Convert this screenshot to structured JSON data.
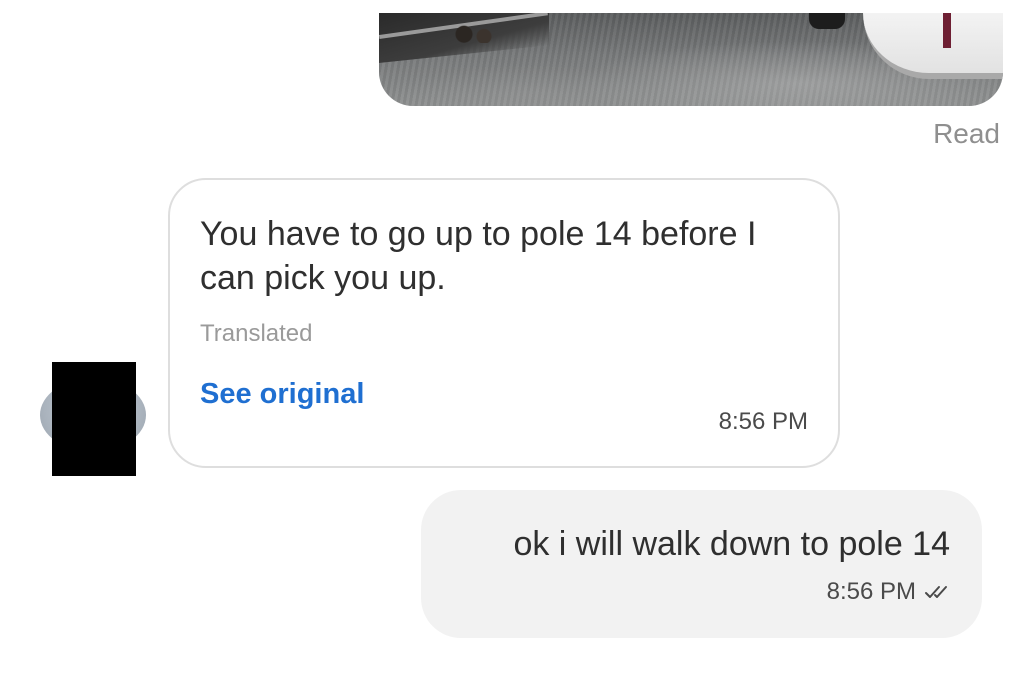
{
  "thread": {
    "read_receipt": "Read",
    "messages": [
      {
        "direction": "incoming",
        "text": "You have to go up to pole 14 before I can pick you up.",
        "translated_label": "Translated",
        "see_original": "See original",
        "time": "8:56 PM"
      },
      {
        "direction": "outgoing",
        "text": "ok i will walk down to pole 14",
        "time": "8:56 PM",
        "status_icon": "double-check-icon"
      }
    ]
  },
  "colors": {
    "link": "#1f6fd1",
    "outgoing_bubble": "#f2f2f2",
    "incoming_border": "#dedede",
    "muted_text": "#8f8f8f"
  }
}
